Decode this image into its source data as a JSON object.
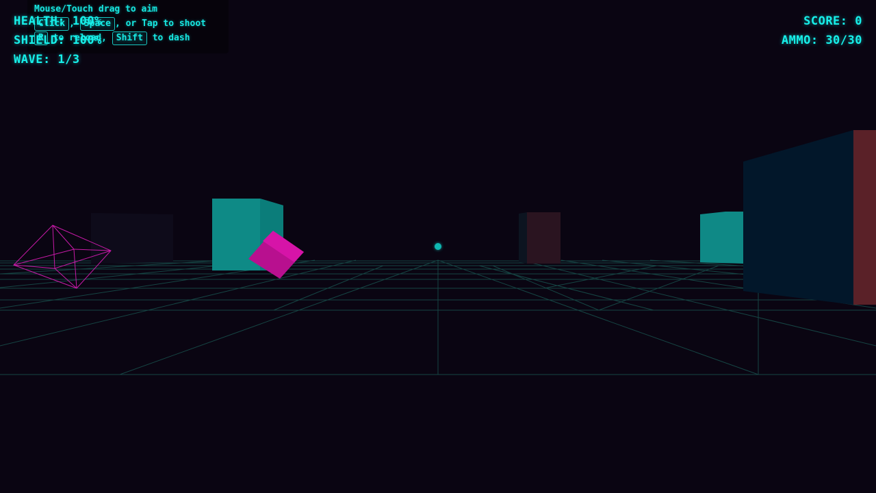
{
  "hud": {
    "health_label": "HEALTH: 100%",
    "shield_label": "SHIELD: 100%",
    "wave_label": "WAVE: 1/3",
    "score_label": "SCORE: 0",
    "ammo_label": "AMMO: 30/30"
  },
  "controls": {
    "aim_text": "Mouse/Touch drag to aim",
    "shoot_key_1": "Click",
    "shoot_key_2": "Space",
    "shoot_text": ", or Tap to shoot",
    "reload_key": "R",
    "reload_text": "to reload,",
    "dash_key": "Shift",
    "dash_text": "to dash"
  },
  "colors": {
    "background": "#0a0512",
    "hud_accent": "#17f0ea",
    "grid": "#1b4a4a",
    "enemy_magenta": "#c8109e",
    "wireframe": "#c81aa8",
    "cube_teal": "#0e8a86",
    "wall_navy": "#02172a",
    "wall_red": "#5a2128"
  },
  "scene": {
    "crosshair_icon": "crosshair-dot",
    "enemy_wireframe_icon": "wireframe-octahedron",
    "enemy_cube_icon": "magenta-cube"
  }
}
